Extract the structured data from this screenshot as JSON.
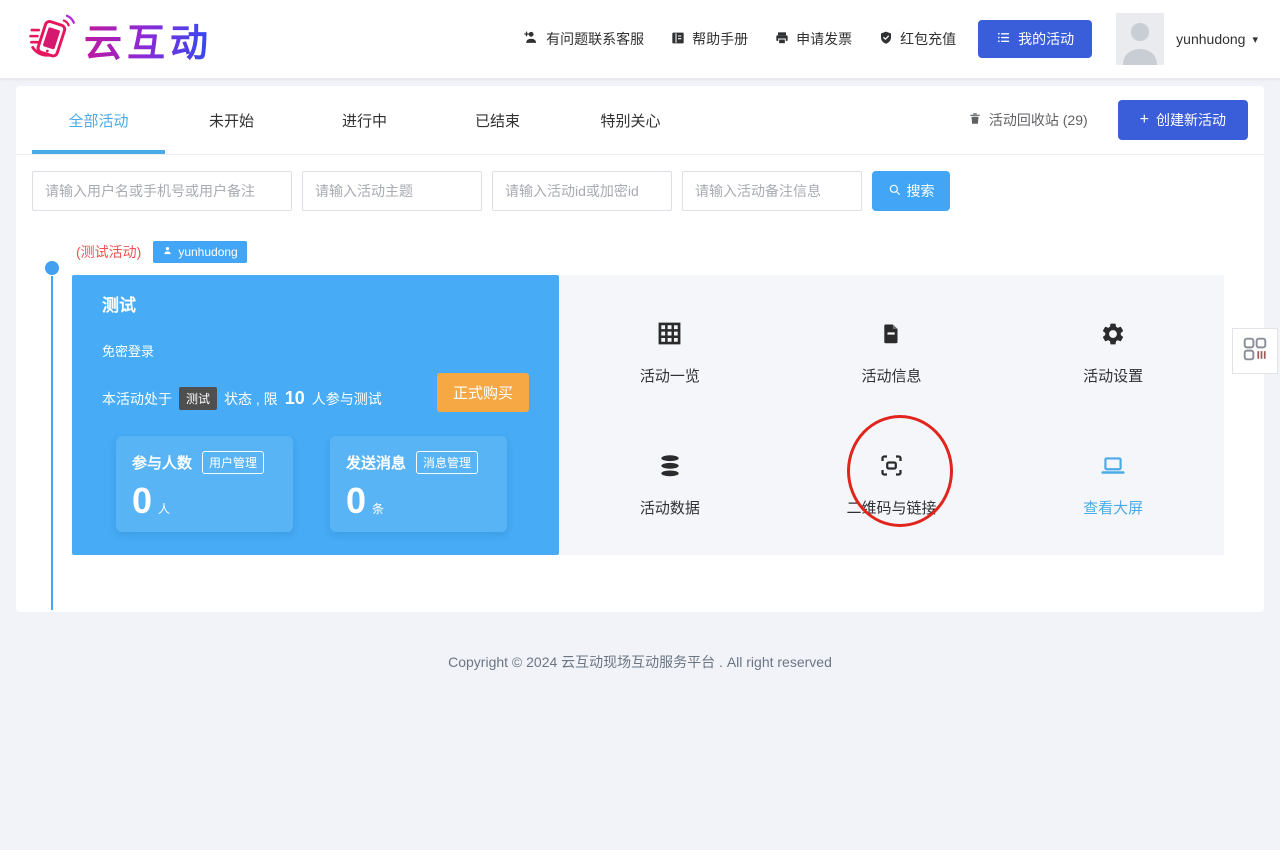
{
  "header": {
    "logo_text": "云互动",
    "nav_items": [
      {
        "label": "有问题联系客服"
      },
      {
        "label": "帮助手册"
      },
      {
        "label": "申请发票"
      },
      {
        "label": "红包充值"
      }
    ],
    "my_activities": "我的活动",
    "username": "yunhudong"
  },
  "tabs": {
    "items": [
      "全部活动",
      "未开始",
      "进行中",
      "已结束",
      "特别关心"
    ],
    "active": "全部活动",
    "recycle_bin": "活动回收站 (29)",
    "create_activity": "创建新活动"
  },
  "search": {
    "placeholders": [
      "请输入用户名或手机号或用户备注",
      "请输入活动主题",
      "请输入活动id或加密id",
      "请输入活动备注信息"
    ],
    "button": "搜索"
  },
  "activity": {
    "tag": "(测试活动)",
    "owner_badge": "yunhudong",
    "card": {
      "title": "测试",
      "subtitle": "免密登录",
      "status_prefix": "本活动处于",
      "status_badge": "测试",
      "status_middle": "状态 , 限",
      "status_limit": "10",
      "status_suffix": "人参与测试",
      "buy_button": "正式购买",
      "stats": [
        {
          "label": "参与人数",
          "badge": "用户管理",
          "value": "0",
          "unit": "人"
        },
        {
          "label": "发送消息",
          "badge": "消息管理",
          "value": "0",
          "unit": "条"
        }
      ]
    },
    "actions": [
      {
        "label": "活动一览"
      },
      {
        "label": "活动信息"
      },
      {
        "label": "活动设置"
      },
      {
        "label": "活动数据"
      },
      {
        "label": "二维码与链接"
      },
      {
        "label": "查看大屏"
      }
    ]
  },
  "footer": {
    "copyright": "Copyright © 2024 云互动现场互动服务平台 . All right reserved"
  },
  "icons": {
    "plus": "+",
    "caret_down": "▾"
  },
  "colors": {
    "primary_blue": "#3a5dd9",
    "sky_blue": "#42a5f5",
    "card_blue": "#47acf5",
    "tab_active_blue": "#4aabe8",
    "orange": "#f6a844",
    "annotation_red": "#e0261c",
    "tag_red": "#f05252"
  }
}
